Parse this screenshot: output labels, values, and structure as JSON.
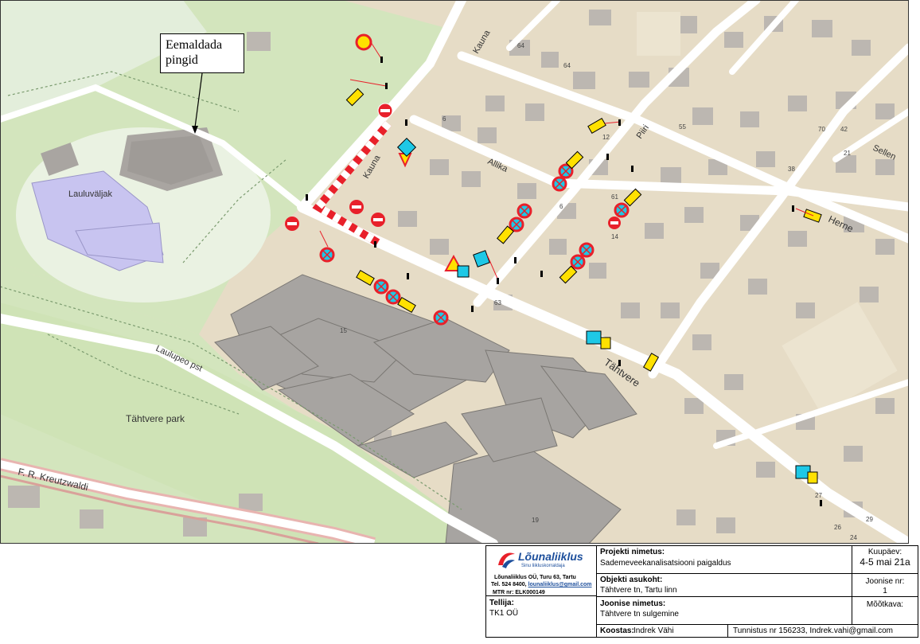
{
  "map": {
    "callout": {
      "line1": "Eemaldada",
      "line2": "pingid"
    },
    "labels": {
      "lauluvaljak": "Lauluväljak",
      "tahtvere_park": "Tähtvere park",
      "laulupeo": "Laulupeo pst",
      "kreutzwaldi": "F. R. Kreutzwaldi",
      "kauna_top": "Kauna",
      "kauna_mid": "Kauna",
      "allika": "Allika",
      "piiri": "Piiri",
      "herne": "Herne",
      "sellen": "Sellen",
      "tahtvere": "Tähtvere"
    },
    "numbers": {
      "n64a": "64",
      "n64b": "64",
      "n6": "6",
      "n12": "12",
      "n55": "55",
      "n38": "38",
      "n70": "70",
      "n42": "42",
      "n21": "21",
      "n6b": "6",
      "n14": "14",
      "n61": "61",
      "n63": "63",
      "n15": "15",
      "n19": "19",
      "n27": "27",
      "n26": "26",
      "n29": "29",
      "n24": "24"
    },
    "colors": {
      "background": "#e6dcc6",
      "building": "#bcb7b1",
      "park": "#d3e5bd",
      "road": "#ffffff",
      "stage": "#c8c4f0",
      "closure_red": "#e8202a",
      "sign_yellow": "#ffe100",
      "sign_blue": "#1ec8e6"
    }
  },
  "titleblock": {
    "logo": {
      "name": "Lõunaliiklus",
      "tagline": "Sinu liikluskorraldaja"
    },
    "company": {
      "line1": "Lõunaliiklus OÜ, Turu 63, Tartu",
      "line2_prefix": "Tel. 524 8400, ",
      "email": "lounaliiklus@gmail.com",
      "line3": "MTR nr: ELK000149"
    },
    "client": {
      "label": "Tellija:",
      "value": "TK1 OÜ"
    },
    "project": {
      "label": "Projekti nimetus:",
      "value": "Sademeveekanalisatsiooni paigaldus"
    },
    "location": {
      "label": "Objekti asukoht:",
      "value": "Tähtvere tn, Tartu linn"
    },
    "drawing": {
      "label": "Joonise nimetus:",
      "value": "Tähtvere tn sulgemine"
    },
    "author": {
      "label": "Koostas:",
      "value": "Indrek Vähi"
    },
    "certificate": "Tunnistus nr 156233, Indrek.vahi@gmail.com",
    "date": {
      "label": "Kuupäev:",
      "value": "4-5 mai 21a"
    },
    "drawing_no": {
      "label": "Joonise nr:",
      "value": "1"
    },
    "scale": {
      "label": "Mõõtkava:"
    }
  }
}
